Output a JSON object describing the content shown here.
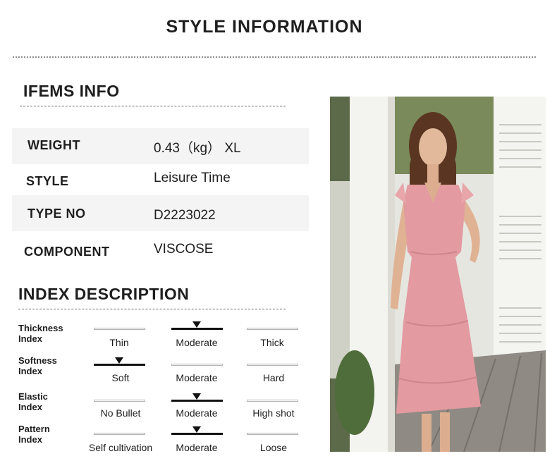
{
  "title": "STYLE INFORMATION",
  "items_info": {
    "heading": "IFEMS INFO",
    "rows": [
      {
        "label": "WEIGHT",
        "value": "0.43（kg） XL"
      },
      {
        "label": "STYLE",
        "value": "Leisure Time"
      },
      {
        "label": "TYPE NO",
        "value": "D2223022"
      },
      {
        "label": "COMPONENT",
        "value": "VISCOSE"
      }
    ]
  },
  "index_description": {
    "heading": "INDEX DESCRIPTION",
    "rows": [
      {
        "label_line1": "Thickness",
        "label_line2": "Index",
        "options": [
          "Thin",
          "Moderate",
          "Thick"
        ],
        "selected": 1
      },
      {
        "label_line1": "Softness",
        "label_line2": "Index",
        "options": [
          "Soft",
          "Moderate",
          "Hard"
        ],
        "selected": 0
      },
      {
        "label_line1": "Elastic",
        "label_line2": "Index",
        "options": [
          "No Bullet",
          "Moderate",
          "High shot"
        ],
        "selected": 1
      },
      {
        "label_line1": "Pattern",
        "label_line2": "Index",
        "options": [
          "Self cultivation",
          "Moderate",
          "Loose"
        ],
        "selected": 1
      }
    ]
  },
  "colors": {
    "dress": "#e39aa0",
    "background": "#ffffff",
    "band": "#f4f4f4",
    "text": "#1e1e1e"
  },
  "icons": {
    "selected_marker": "triangle-down-icon"
  }
}
